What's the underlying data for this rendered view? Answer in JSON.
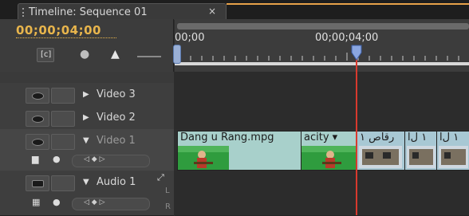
{
  "panel": {
    "tab_title": "Timeline: Sequence 01",
    "close_glyph": "×",
    "current_timecode": "00;00;04;00"
  },
  "toolbar": {
    "snap_icon": "snap-icon",
    "marker_icon": "marker-icon",
    "set_marker_icon": "set-marker-icon",
    "snap_glyph": "[c]",
    "marker_glyph": "●",
    "set_marker_glyph": "▲"
  },
  "ruler": {
    "labels": [
      "00;00",
      "00;00;04;00"
    ]
  },
  "tracks": {
    "video3": {
      "name": "Video 3"
    },
    "video2": {
      "name": "Video 2"
    },
    "video1": {
      "name": "Video 1"
    },
    "audio1": {
      "name": "Audio 1"
    },
    "keynav_glyphs": "◁ ◆ ▷",
    "expand_glyph": "▶",
    "collapse_glyph": "▼"
  },
  "clips": [
    {
      "label": "Dang u Rang.mpg",
      "kind": "video"
    },
    {
      "label": "acity ▾",
      "kind": "opacity-menu"
    },
    {
      "label": "ﺭﻗﺎﺹ ١",
      "kind": "video"
    },
    {
      "label": "١ ﻝﺍ",
      "kind": "video"
    },
    {
      "label": "١ ﻝﺍ",
      "kind": "video"
    }
  ],
  "audio_side_labels": [
    "L",
    "R"
  ],
  "colors": {
    "timecode": "#e8b54c",
    "playhead": "#d83a2e",
    "clip_video": "#a8d0cb",
    "tab_accent": "#e8a24a"
  }
}
